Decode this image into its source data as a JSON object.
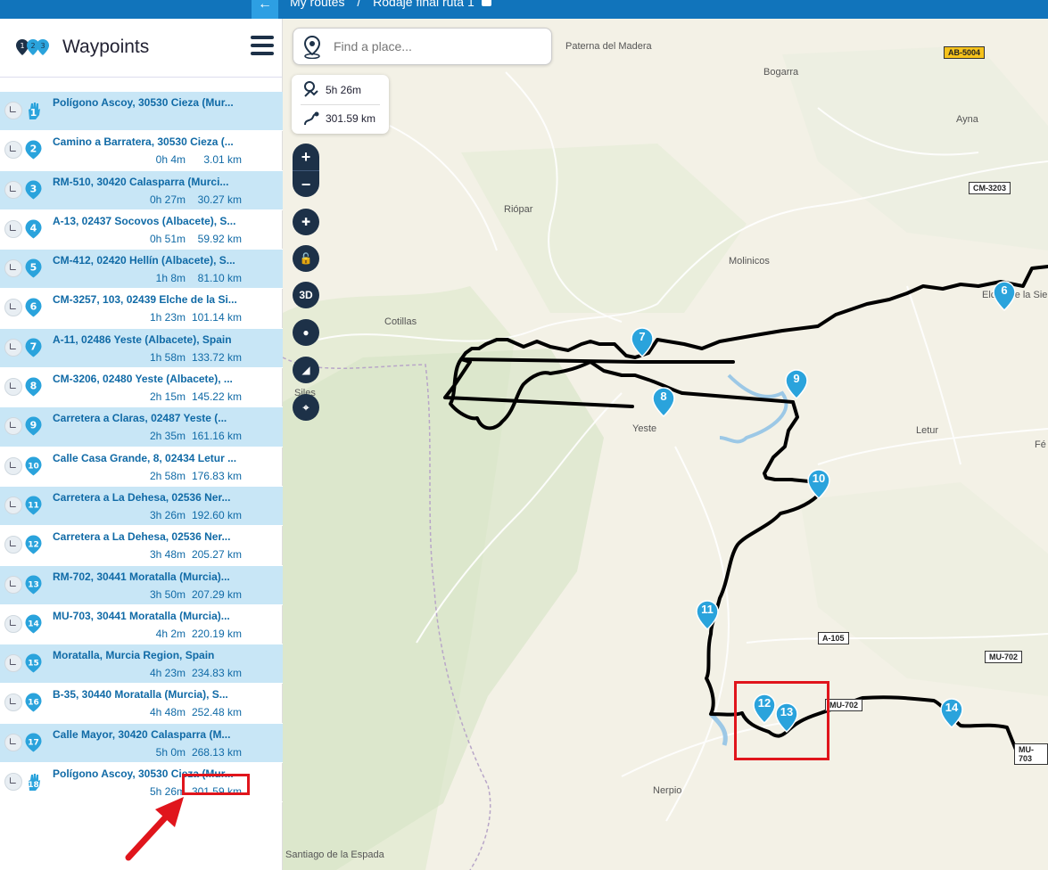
{
  "topbar": {
    "back_icon": "arrow-left-icon",
    "crumb1": "My routes",
    "separator": "/",
    "crumb2": "Rodaje final ruta 1"
  },
  "sidebar": {
    "title": "Waypoints",
    "items": [
      {
        "num": "1",
        "address": "Polígono Ascoy, 30530 Cieza (Mur...",
        "time": "",
        "dist": "",
        "alt": true,
        "icon": "hand-icon"
      },
      {
        "num": "2",
        "address": "Camino a Barratera, 30530 Cieza (...",
        "time": "0h 4m",
        "dist": "3.01 km",
        "alt": false
      },
      {
        "num": "3",
        "address": "RM-510, 30420 Calasparra (Murci...",
        "time": "0h 27m",
        "dist": "30.27 km",
        "alt": true
      },
      {
        "num": "4",
        "address": "A-13, 02437 Socovos (Albacete), S...",
        "time": "0h 51m",
        "dist": "59.92 km",
        "alt": false
      },
      {
        "num": "5",
        "address": "CM-412, 02420 Hellín (Albacete), S...",
        "time": "1h 8m",
        "dist": "81.10 km",
        "alt": true
      },
      {
        "num": "6",
        "address": "CM-3257, 103, 02439 Elche de la Si...",
        "time": "1h 23m",
        "dist": "101.14 km",
        "alt": false
      },
      {
        "num": "7",
        "address": "A-11, 02486 Yeste (Albacete), Spain",
        "time": "1h 58m",
        "dist": "133.72 km",
        "alt": true
      },
      {
        "num": "8",
        "address": "CM-3206, 02480 Yeste (Albacete), ...",
        "time": "2h 15m",
        "dist": "145.22 km",
        "alt": false
      },
      {
        "num": "9",
        "address": "Carretera a Claras, 02487 Yeste (...",
        "time": "2h 35m",
        "dist": "161.16 km",
        "alt": true
      },
      {
        "num": "10",
        "address": "Calle Casa Grande, 8, 02434 Letur ...",
        "time": "2h 58m",
        "dist": "176.83 km",
        "alt": false
      },
      {
        "num": "11",
        "address": "Carretera a La Dehesa, 02536 Ner...",
        "time": "3h 26m",
        "dist": "192.60 km",
        "alt": true
      },
      {
        "num": "12",
        "address": "Carretera a La Dehesa, 02536 Ner...",
        "time": "3h 48m",
        "dist": "205.27 km",
        "alt": false
      },
      {
        "num": "13",
        "address": "RM-702, 30441 Moratalla (Murcia)...",
        "time": "3h 50m",
        "dist": "207.29 km",
        "alt": true
      },
      {
        "num": "14",
        "address": "MU-703, 30441 Moratalla (Murcia)...",
        "time": "4h 2m",
        "dist": "220.19 km",
        "alt": false
      },
      {
        "num": "15",
        "address": "Moratalla, Murcia Region, Spain",
        "time": "4h 23m",
        "dist": "234.83 km",
        "alt": true
      },
      {
        "num": "16",
        "address": "B-35, 30440 Moratalla (Murcia), S...",
        "time": "4h 48m",
        "dist": "252.48 km",
        "alt": false
      },
      {
        "num": "17",
        "address": "Calle Mayor, 30420 Calasparra (M...",
        "time": "5h 0m",
        "dist": "268.13 km",
        "alt": true
      },
      {
        "num": "18",
        "address": "Polígono Ascoy, 30530 Cieza (Mur...",
        "time": "5h 26m",
        "dist": "301.59 km",
        "alt": false,
        "icon": "hand-icon"
      }
    ]
  },
  "map": {
    "search_placeholder": "Find a place...",
    "total_time": "5h 26m",
    "total_dist": "301.59 km",
    "zoom_in": "+",
    "zoom_out": "−",
    "btn_3d": "3D",
    "labels": {
      "paterna": "Paterna del Madera",
      "bogarra": "Bogarra",
      "ayna": "Ayna",
      "riopar": "Riópar",
      "molinicos": "Molinicos",
      "cotillas": "Cotillas",
      "elche": "Elche de la Sierra",
      "yeste": "Yeste",
      "letur": "Letur",
      "silos": "Siles",
      "nerpio": "Nerpio",
      "santiago": "Santiago de la Espada",
      "fe": "Fé"
    },
    "roads": {
      "ab5004": "AB-5004",
      "cm3203": "CM-3203",
      "a105": "A-105",
      "mu702": "MU-702",
      "mu702b": "MU-702",
      "mu703": "MU-703"
    },
    "accent": "#2aa3dc",
    "route_color": "#000000",
    "highlight_color": "#e0151c"
  }
}
